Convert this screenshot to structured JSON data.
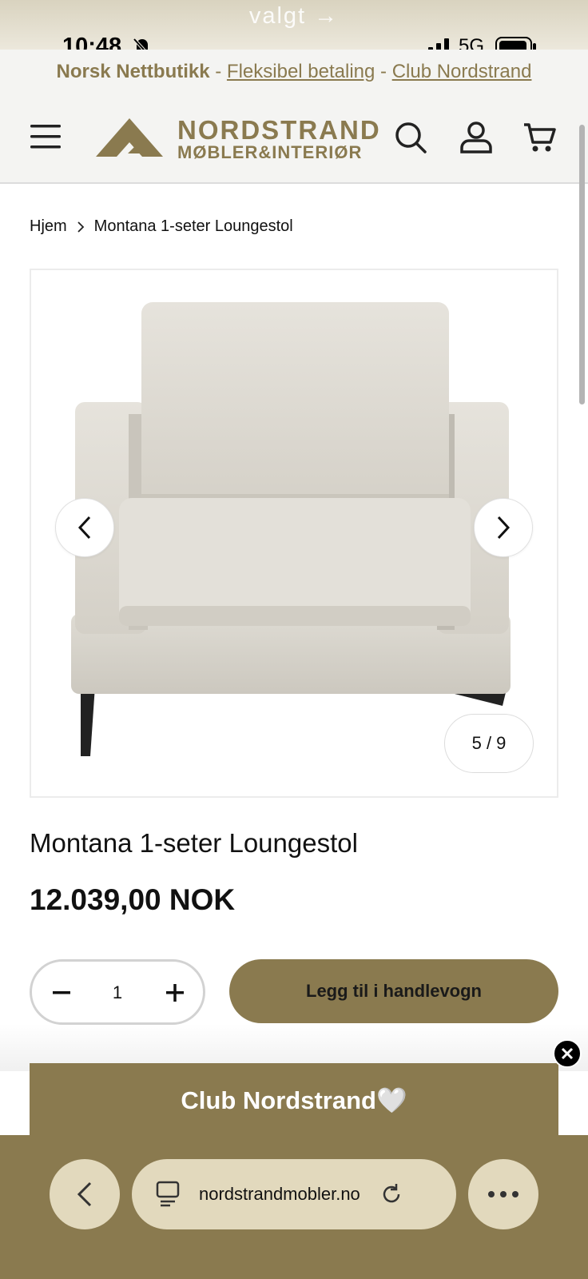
{
  "top_chrome": {
    "peek_text": "valgt →"
  },
  "status_bar": {
    "time": "10:48",
    "network": "5G"
  },
  "promo": {
    "left": "Norsk Nettbutikk",
    "sep1": " - ",
    "middle": "Fleksibel betaling",
    "sep2": " - ",
    "right": "Club Nordstrand"
  },
  "logo": {
    "line1": "NORDSTRAND",
    "line2": "MØBLER&INTERIØR"
  },
  "breadcrumb": {
    "home": "Hjem",
    "current": "Montana 1-seter Loungestol"
  },
  "gallery": {
    "counter": "5 / 9"
  },
  "product": {
    "title": "Montana 1-seter Loungestol",
    "price": "12.039,00 NOK",
    "quantity": "1",
    "add_to_cart": "Legg til i handlevogn"
  },
  "club": {
    "label": "Club Nordstrand🤍"
  },
  "browser": {
    "url": "nordstrandmobler.no"
  },
  "colors": {
    "brand": "#8a7a4f",
    "brand_light": "#e2d9bd"
  }
}
